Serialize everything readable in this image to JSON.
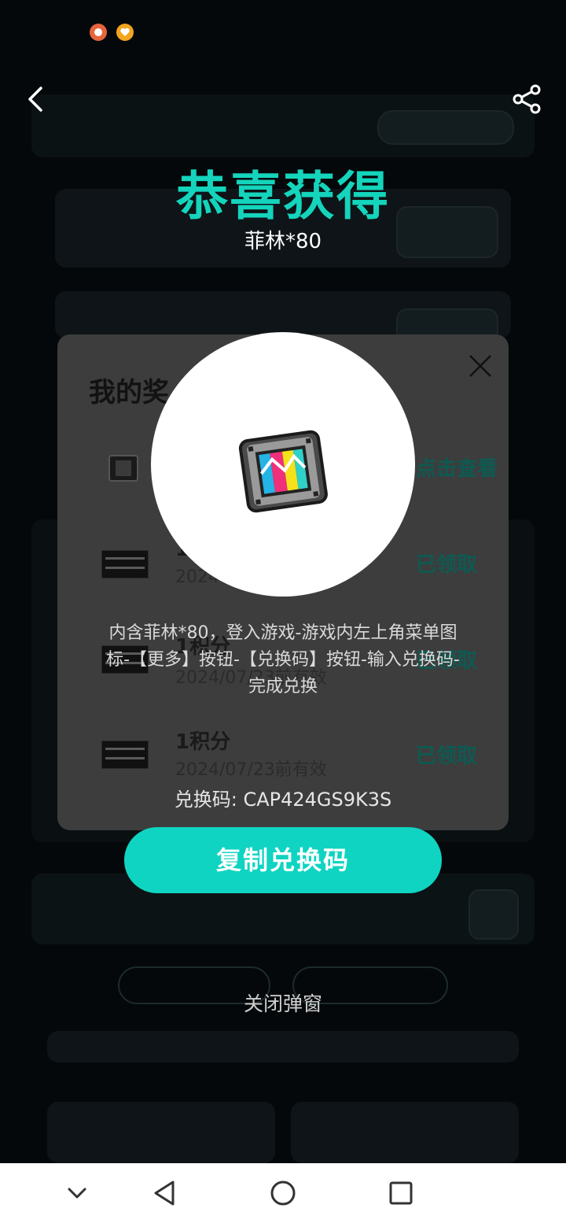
{
  "header": {
    "title": "恭喜获得",
    "reward_name": "菲林*80"
  },
  "rewards_panel": {
    "title": "我的奖",
    "rows": [
      {
        "title": "",
        "date": "",
        "status": "点击查看"
      },
      {
        "title": "1",
        "date": "2024",
        "status": "已领取"
      },
      {
        "title": "1积分",
        "date": "2024/07/23前有效",
        "status": "已领取"
      },
      {
        "title": "1积分",
        "date": "2024/07/23前有效",
        "status": "已领取"
      }
    ]
  },
  "popup": {
    "description": "内含菲林*80，登入游戏-游戏内左上角菜单图标-【更多】按钮-【兑换码】按钮-输入兑换码-完成兑换",
    "code_label": "兑换码: CAP424GS9K3S",
    "copy_button": "复制兑换码",
    "close_link": "关闭弹窗"
  },
  "colors": {
    "accent": "#14d4bc",
    "button": "#0fd4c2",
    "panel": "#3d3d3d"
  },
  "icons": {
    "back": "chevron-left-icon",
    "share": "share-icon",
    "close": "close-icon",
    "prize": "film-reel-icon"
  }
}
